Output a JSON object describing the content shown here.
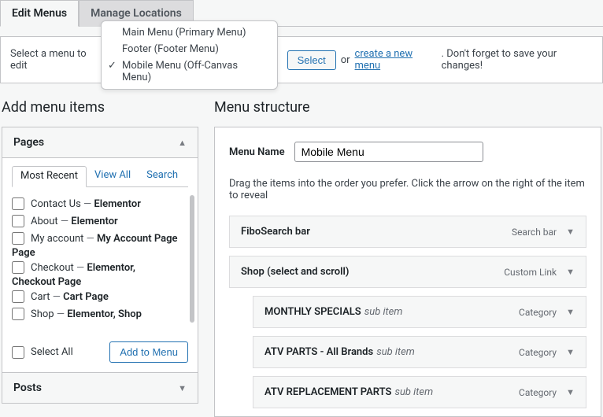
{
  "tabs": {
    "edit": "Edit Menus",
    "manage": "Manage Locations"
  },
  "selectBar": {
    "prefix": "Select a menu to edit",
    "selectBtn": "Select",
    "or": "or",
    "createLink": "create a new menu",
    "suffix": ". Don't forget to save your changes!"
  },
  "dropdown": {
    "items": [
      "Main Menu (Primary Menu)",
      "Footer (Footer Menu)",
      "Mobile Menu (Off-Canvas Menu)"
    ],
    "checkedIndex": 2
  },
  "leftHeading": "Add menu items",
  "rightHeading": "Menu structure",
  "accordion": {
    "pages": "Pages",
    "posts": "Posts",
    "subtabs": {
      "recent": "Most Recent",
      "viewall": "View All",
      "search": "Search"
    },
    "selectAll": "Select All",
    "addBtn": "Add to Menu"
  },
  "pageItems": [
    {
      "label": "Contact Us",
      "desc": "Elementor"
    },
    {
      "label": "About",
      "desc": "Elementor"
    },
    {
      "label": "My account",
      "desc": "My Account Page",
      "wrap": true
    },
    {
      "label": "Checkout",
      "desc": "Elementor, Checkout Page",
      "wrap": true
    },
    {
      "label": "Cart",
      "desc": "Cart Page"
    },
    {
      "label": "Shop",
      "desc": "Elementor, Shop"
    }
  ],
  "menuNameLabel": "Menu Name",
  "menuNameValue": "Mobile Menu",
  "instructions": "Drag the items into the order you prefer. Click the arrow on the right of the item to reveal",
  "menuItems": [
    {
      "title": "FiboSearch bar",
      "type": "Search bar",
      "indent": 0
    },
    {
      "title": "Shop (select and scroll)",
      "type": "Custom Link",
      "indent": 0
    },
    {
      "title": "MONTHLY SPECIALS",
      "sub": "sub item",
      "type": "Category",
      "indent": 1
    },
    {
      "title": "ATV PARTS - All Brands",
      "sub": "sub item",
      "type": "Category",
      "indent": 1
    },
    {
      "title": "ATV REPLACEMENT PARTS",
      "sub": "sub item",
      "type": "Category",
      "indent": 1
    }
  ]
}
